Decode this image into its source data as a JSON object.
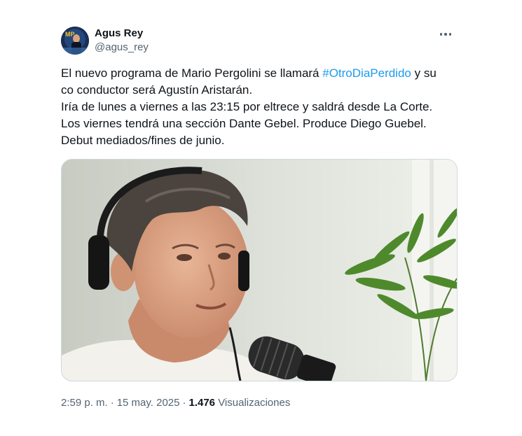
{
  "tweet": {
    "author": {
      "display_name": "Agus Rey",
      "handle": "@agus_rey",
      "avatar_icon": "avatar-image"
    },
    "more_icon": "more-options-icon",
    "text": {
      "line1_before": "El nuevo programa de Mario Pergolini se llamará ",
      "hashtag": "#OtroDiaPerdido",
      "line1_after": " y su co conductor será Agustín Aristarán.",
      "line2": "Iría de lunes a viernes a las 23:15 por eltrece y saldrá desde La Corte.",
      "line3": "Los viernes tendrá una sección Dante Gebel. Produce Diego Guebel.",
      "line4": "Debut mediados/fines de junio."
    },
    "media": {
      "kind": "photo"
    },
    "meta": {
      "time": "2:59 p. m.",
      "separator": "·",
      "date": "15 may. 2025",
      "views_count": "1.476",
      "views_label": "Visualizaciones"
    },
    "colors": {
      "text": "#0f1419",
      "secondary": "#536471",
      "link": "#1d9bf0",
      "border": "#cfd9de"
    }
  }
}
